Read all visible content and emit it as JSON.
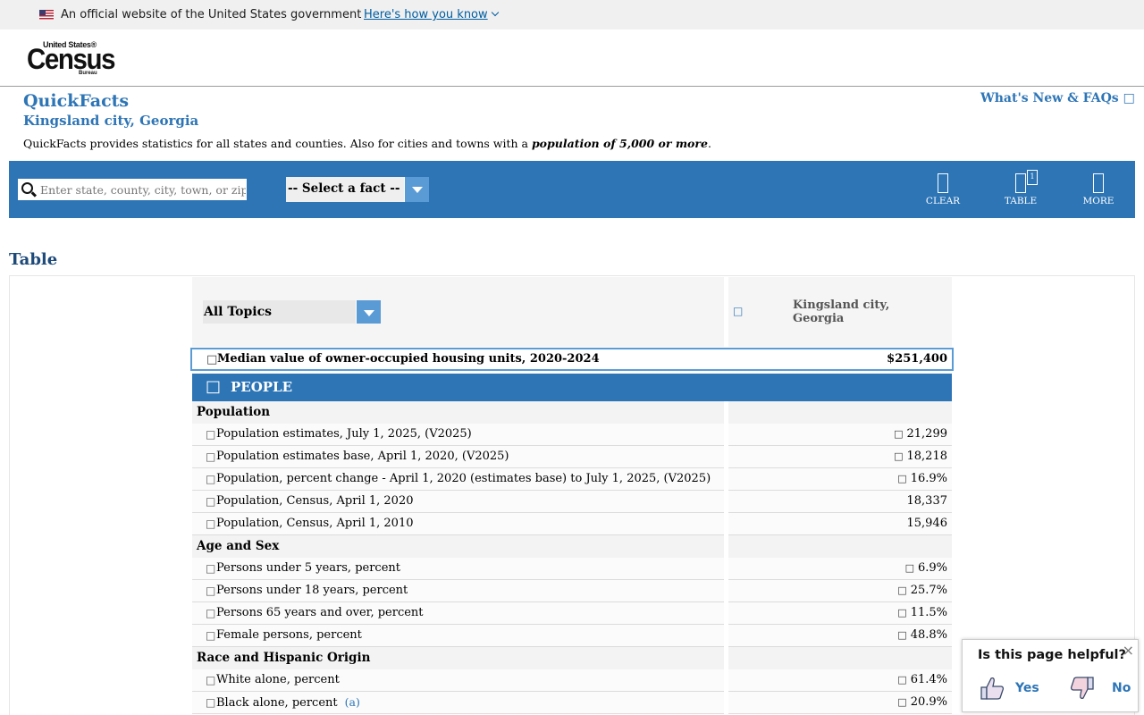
{
  "banner": {
    "text": "An official website of the United States government",
    "link": "Here's how you know"
  },
  "logo": {
    "line1": "United States®",
    "line2": "Census",
    "line3": "Bureau"
  },
  "header": {
    "title": "QuickFacts",
    "subtitle": "Kingsland city, Georgia",
    "whats_new": "What's New & FAQs",
    "description_prefix": "QuickFacts provides statistics for all states and counties. Also for cities and towns with a ",
    "description_emphasis": "population of 5,000 or more",
    "description_suffix": "."
  },
  "toolbar": {
    "search_placeholder": "Enter state, county, city, town, or zip code",
    "fact_select": "-- Select a fact --",
    "clear_label": "CLEAR",
    "table_label": "TABLE",
    "table_badge": "1",
    "more_label": "MORE"
  },
  "table": {
    "heading": "Table",
    "topic_select": "All Topics",
    "place_name": "Kingsland city, Georgia",
    "median_label": "Median value of owner-occupied housing units, 2020-2024",
    "median_value": "$251,400",
    "section": "PEOPLE",
    "groups": [
      {
        "name": "Population",
        "rows": [
          {
            "label": "Population estimates, July 1, 2025, (V2025)",
            "value": "21,299",
            "flag": true
          },
          {
            "label": "Population estimates base, April 1, 2020, (V2025)",
            "value": "18,218",
            "flag": true
          },
          {
            "label": "Population, percent change - April 1, 2020 (estimates base) to July 1, 2025, (V2025)",
            "value": "16.9%",
            "flag": true
          },
          {
            "label": "Population, Census, April 1, 2020",
            "value": "18,337",
            "flag": false
          },
          {
            "label": "Population, Census, April 1, 2010",
            "value": "15,946",
            "flag": false
          }
        ]
      },
      {
        "name": "Age and Sex",
        "rows": [
          {
            "label": "Persons under 5 years, percent",
            "value": "6.9%",
            "flag": true
          },
          {
            "label": "Persons under 18 years, percent",
            "value": "25.7%",
            "flag": true
          },
          {
            "label": "Persons 65 years and over, percent",
            "value": "11.5%",
            "flag": true
          },
          {
            "label": "Female persons, percent",
            "value": "48.8%",
            "flag": true
          }
        ]
      },
      {
        "name": "Race and Hispanic Origin",
        "rows": [
          {
            "label": "White alone, percent",
            "value": "61.4%",
            "flag": true
          },
          {
            "label": "Black alone, percent",
            "value": "20.9%",
            "flag": true,
            "note": "(a)"
          }
        ]
      }
    ]
  },
  "feedback": {
    "question": "Is this page helpful?",
    "yes": "Yes",
    "no": "No",
    "close": "×"
  },
  "colors": {
    "accent": "#2e75b6",
    "light_accent": "#5b9bd5",
    "banner_bg": "#f0f0f0"
  }
}
